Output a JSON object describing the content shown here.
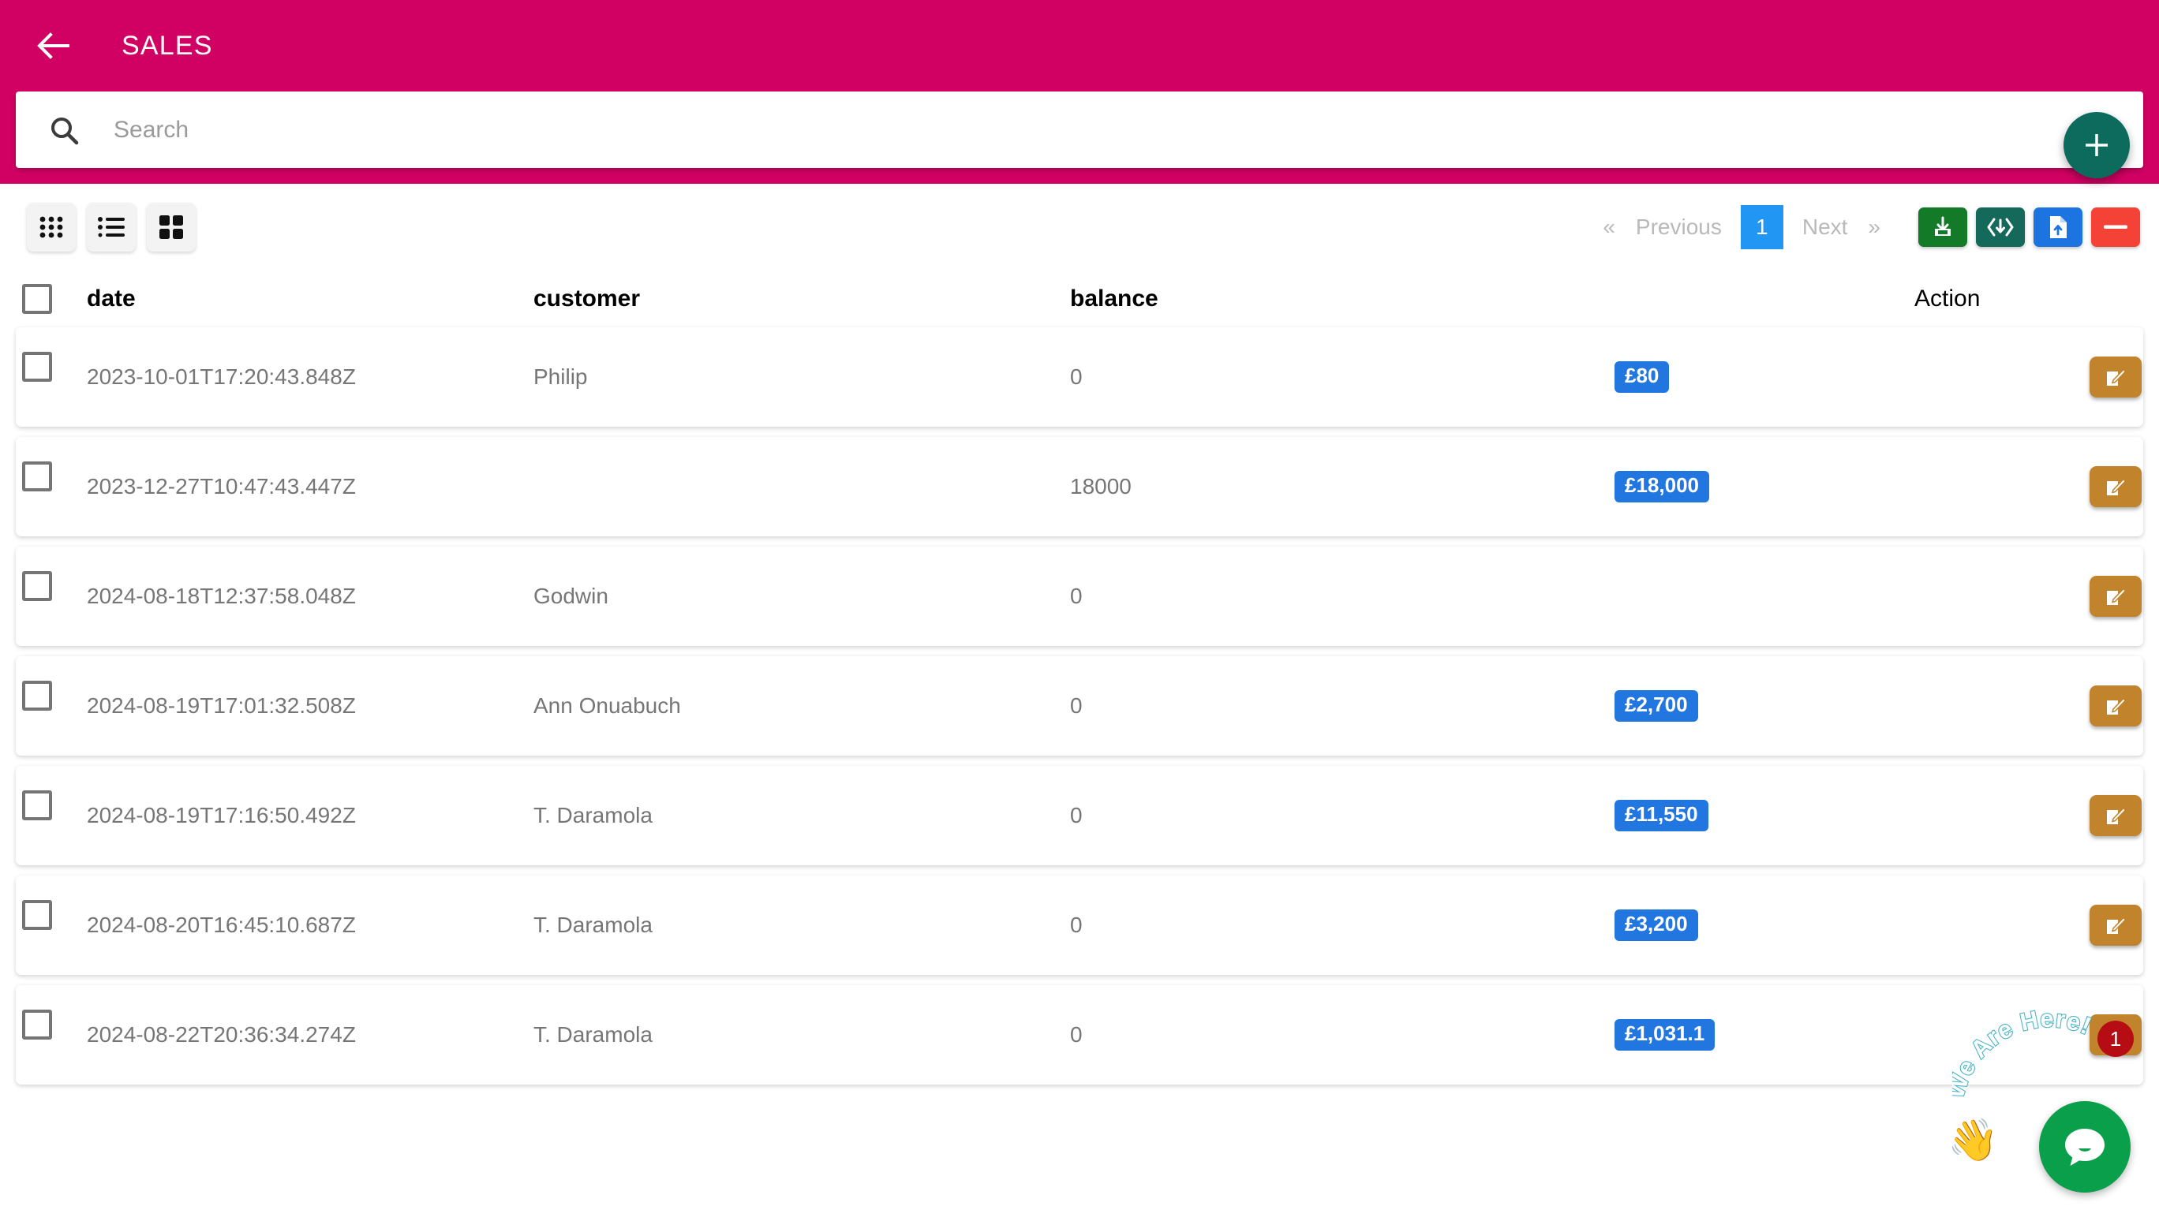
{
  "appbar": {
    "title": "SALES",
    "back_icon": "arrow-left-icon",
    "bg_color": "#d10063"
  },
  "search": {
    "placeholder": "Search",
    "value": "",
    "icon": "search-icon"
  },
  "fab": {
    "label": "+",
    "icon": "plus-icon",
    "color": "#0c6b5c"
  },
  "toolbar": {
    "view_modes": [
      {
        "name": "grid-dots-view",
        "icon": "grid-dots-icon"
      },
      {
        "name": "list-view",
        "icon": "list-icon"
      },
      {
        "name": "card-grid-view",
        "icon": "grid-squares-icon"
      }
    ],
    "pagination": {
      "first_chevron": "«",
      "previous_label": "Previous",
      "current_page": "1",
      "next_label": "Next",
      "last_chevron": "»",
      "active_color": "#2196f3"
    },
    "actions": [
      {
        "name": "download-button",
        "icon": "download-icon",
        "color": "#137a28"
      },
      {
        "name": "export-code-button",
        "icon": "code-download-icon",
        "color": "#15695b"
      },
      {
        "name": "upload-file-button",
        "icon": "file-upload-icon",
        "color": "#1c74e0"
      },
      {
        "name": "delete-button",
        "icon": "minus-icon",
        "color": "#f44336"
      }
    ]
  },
  "table": {
    "columns": [
      "date",
      "customer",
      "balance",
      "",
      "Action"
    ],
    "header_checkbox": false,
    "rows": [
      {
        "checked": false,
        "date": "2023-10-01T17:20:43.848Z",
        "customer": "Philip",
        "balance": "0",
        "badge": "£80",
        "action_icon": "edit-icon"
      },
      {
        "checked": false,
        "date": "2023-12-27T10:47:43.447Z",
        "customer": "",
        "balance": "18000",
        "badge": "£18,000",
        "action_icon": "edit-icon"
      },
      {
        "checked": false,
        "date": "2024-08-18T12:37:58.048Z",
        "customer": "Godwin",
        "balance": "0",
        "badge": "",
        "action_icon": "edit-icon"
      },
      {
        "checked": false,
        "date": "2024-08-19T17:01:32.508Z",
        "customer": "Ann Onuabuch",
        "balance": "0",
        "badge": "£2,700",
        "action_icon": "edit-icon"
      },
      {
        "checked": false,
        "date": "2024-08-19T17:16:50.492Z",
        "customer": "T. Daramola",
        "balance": "0",
        "badge": "£11,550",
        "action_icon": "edit-icon"
      },
      {
        "checked": false,
        "date": "2024-08-20T16:45:10.687Z",
        "customer": "T. Daramola",
        "balance": "0",
        "badge": "£3,200",
        "action_icon": "edit-icon"
      },
      {
        "checked": false,
        "date": "2024-08-22T20:36:34.274Z",
        "customer": "T. Daramola",
        "balance": "0",
        "badge": "£1,031.1",
        "action_icon": "edit-icon"
      }
    ]
  },
  "chat_widget": {
    "arc_text": "We Are Here!",
    "hand_icon": "waving-hand-icon",
    "bubble_icon": "chat-bubble-icon",
    "unread_count": "1",
    "color": "#0aa04b",
    "badge_color": "#b50d13"
  }
}
